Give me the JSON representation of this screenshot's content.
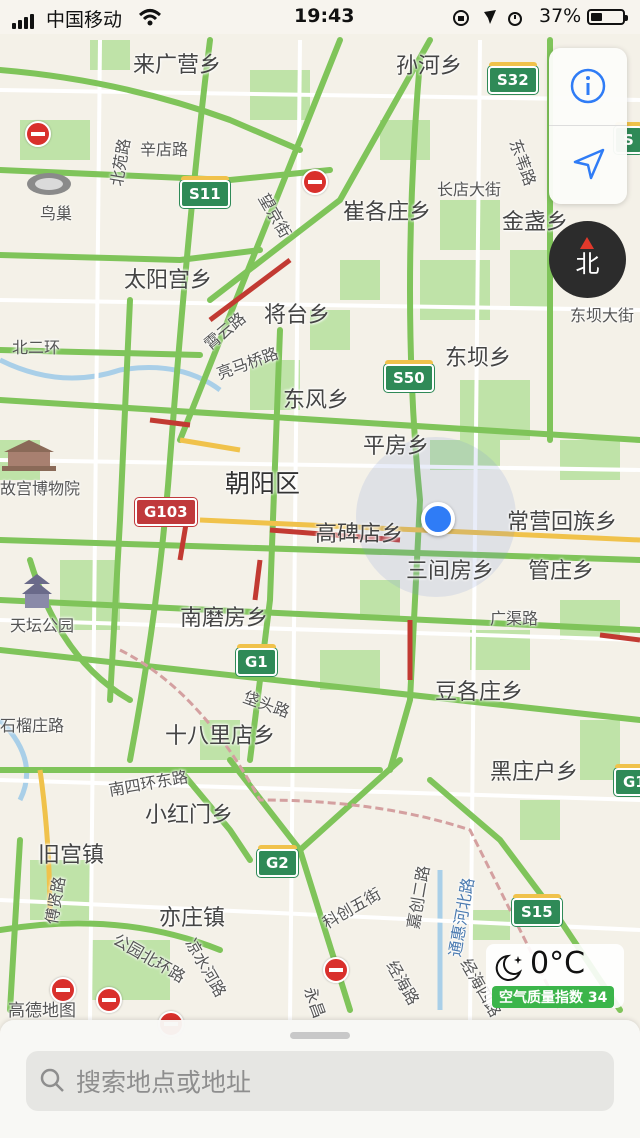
{
  "status_bar": {
    "carrier": "中国移动",
    "time": "19:43",
    "battery_percent": "37%",
    "battery_level": 0.37
  },
  "map": {
    "area_labels": [
      "来广营乡",
      "孙河乡",
      "崔各庄乡",
      "金盏乡",
      "太阳宫乡",
      "将台乡",
      "东坝乡",
      "东风乡",
      "平房乡",
      "常营回族乡",
      "高碑店乡",
      "三间房乡",
      "管庄乡",
      "南磨房乡",
      "豆各庄乡",
      "十八里店乡",
      "黑庄户乡",
      "小红门乡",
      "旧宫镇",
      "亦庄镇"
    ],
    "district_label": "朝阳区",
    "street_labels": [
      "辛店路",
      "北苑路",
      "望京街",
      "长店大街",
      "东苇路",
      "东坝大街",
      "北二环",
      "霄云路",
      "亮马桥路",
      "广渠路",
      "垡头路",
      "石榴庄路",
      "南四环东路",
      "科创五街",
      "嘉创二路",
      "通惠河北路",
      "公园北环路",
      "凉水河路",
      "经海路",
      "经海四路",
      "傅贤路",
      "永昌"
    ],
    "poi_labels": [
      "鸟巢",
      "故宫博物院",
      "天坛公园",
      "高德地图"
    ],
    "road_shields": [
      "S32",
      "S11",
      "S50",
      "G103",
      "G1",
      "G2",
      "S15",
      "G1",
      "S"
    ],
    "colors": {
      "road_green": "#7fc45a",
      "road_yellow": "#f0c24b",
      "road_red": "#c23a32",
      "park": "#bfe3a8",
      "water": "#a9cfe8",
      "background": "#f4f1e8"
    }
  },
  "controls": {
    "info_icon": "info-icon",
    "locate_icon": "location-arrow-icon",
    "compass_label": "北"
  },
  "weather": {
    "temperature": "0°C",
    "air_quality": "空气质量指数 34"
  },
  "search": {
    "placeholder": "搜索地点或地址",
    "value": ""
  }
}
